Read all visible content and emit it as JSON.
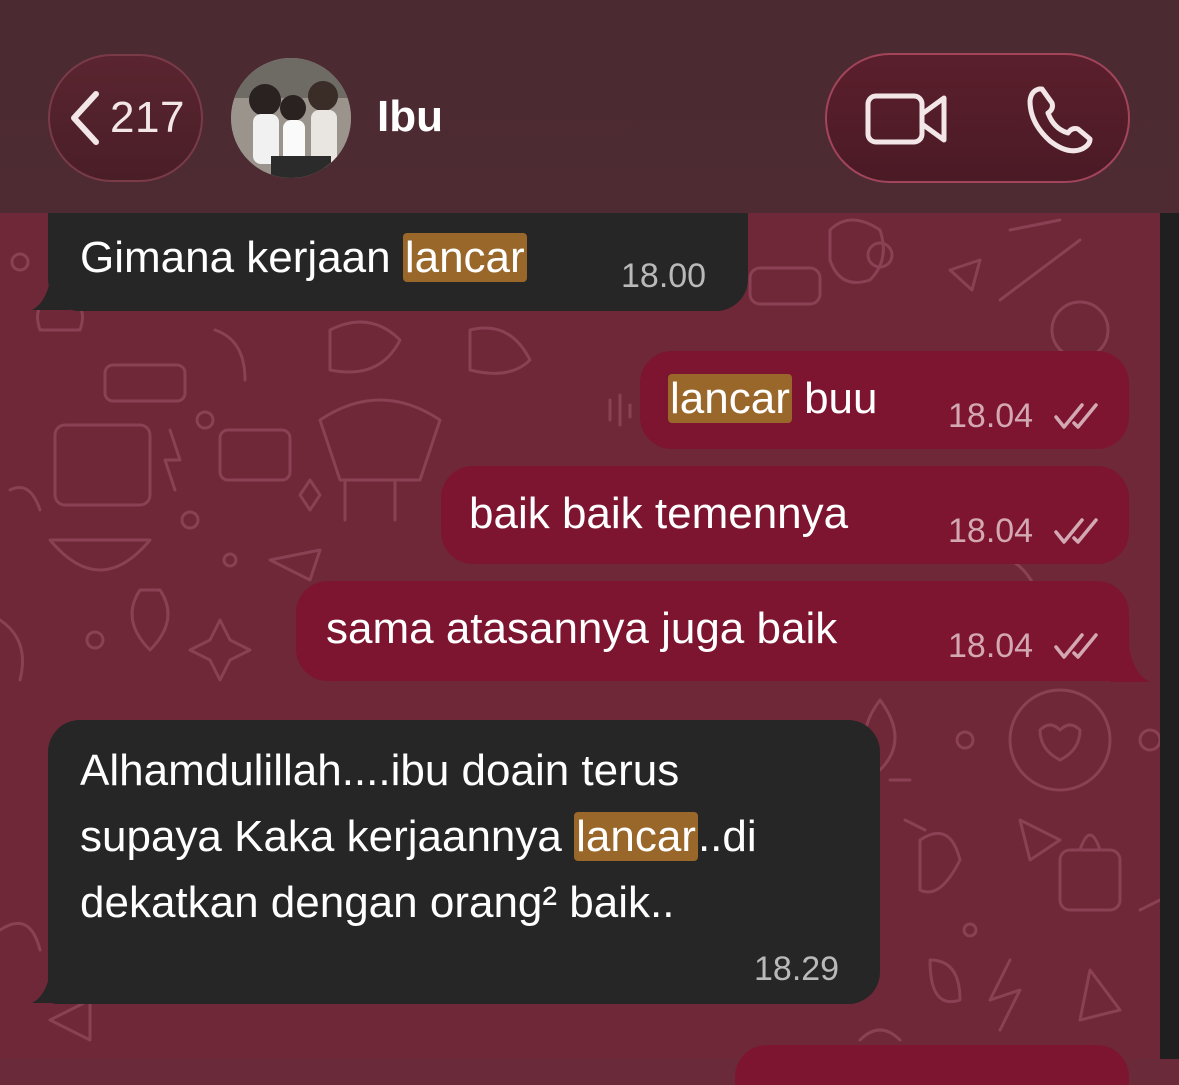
{
  "header": {
    "back_count": "217",
    "contact_name": "Ibu"
  },
  "icons": {
    "back": "chevron-left-icon",
    "video": "video-camera-icon",
    "phone": "phone-icon",
    "read": "double-check-icon"
  },
  "colors": {
    "incoming_bubble": "#262626",
    "outgoing_bubble": "#7d1530",
    "highlight": "#99672a",
    "wallpaper": "#6e2838"
  },
  "messages": [
    {
      "direction": "in",
      "pre": "Gimana kerjaan ",
      "highlight": "lancar",
      "post": "",
      "time": "18.00"
    },
    {
      "direction": "out",
      "pre": "",
      "highlight": "lancar",
      "post": " buu",
      "time": "18.04"
    },
    {
      "direction": "out",
      "text": "baik baik temennya",
      "time": "18.04"
    },
    {
      "direction": "out",
      "text": "sama atasannya juga baik",
      "time": "18.04"
    },
    {
      "direction": "in",
      "line1": "Alhamdulillah....ibu doain terus",
      "line2_pre": "supaya Kaka kerjaannya ",
      "line2_highlight": "lancar",
      "line2_post": "..di",
      "line3": "dekatkan dengan orang² baik..",
      "time": "18.29"
    }
  ]
}
